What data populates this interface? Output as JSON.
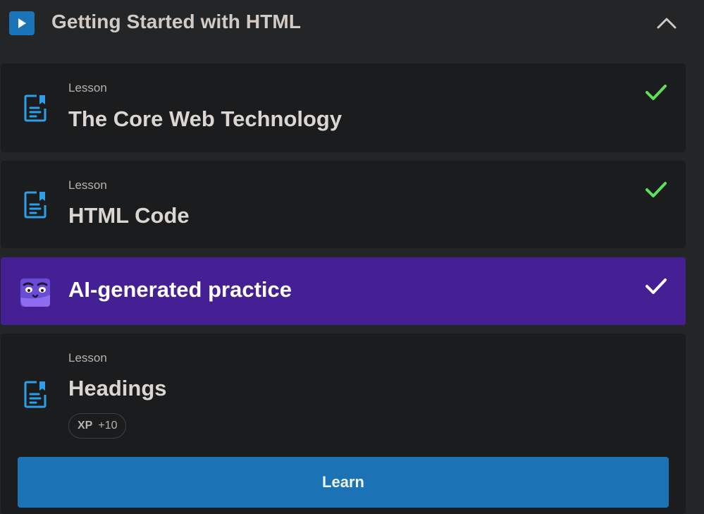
{
  "module": {
    "title": "Getting Started with HTML",
    "icon": "play-icon",
    "expanded": true
  },
  "items": [
    {
      "type_label": "Lesson",
      "title": "The Core Web Technology",
      "icon": "lesson-document-icon",
      "status_icon": "check-icon",
      "completed": true
    },
    {
      "type_label": "Lesson",
      "title": "HTML Code",
      "icon": "lesson-document-icon",
      "status_icon": "check-icon",
      "completed": true
    },
    {
      "title": "AI-generated practice",
      "icon": "ai-practice-avatar-icon",
      "status_icon": "check-icon",
      "completed": true
    },
    {
      "type_label": "Lesson",
      "title": "Headings",
      "icon": "lesson-document-icon",
      "xp_label": "XP",
      "xp_value": "+10",
      "button_label": "Learn",
      "completed": false
    }
  ],
  "colors": {
    "background": "#242526",
    "card": "#1b1c1e",
    "practice_card": "#451f94",
    "accent_blue": "#1b72b4",
    "icon_blue": "#2d9ee8",
    "check_green": "#5fe05a",
    "check_white": "#ffffff"
  }
}
